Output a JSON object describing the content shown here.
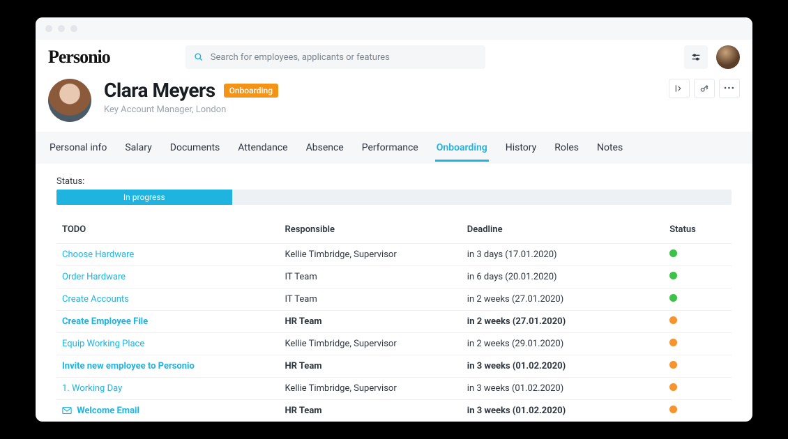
{
  "app": {
    "logo_text": "Personio"
  },
  "search": {
    "placeholder": "Search for employees, applicants or features"
  },
  "profile": {
    "name": "Clara Meyers",
    "badge": "Onboarding",
    "subtitle": "Key Account Manager, London"
  },
  "tabs": [
    {
      "label": "Personal info",
      "active": false
    },
    {
      "label": "Salary",
      "active": false
    },
    {
      "label": "Documents",
      "active": false
    },
    {
      "label": "Attendance",
      "active": false
    },
    {
      "label": "Absence",
      "active": false
    },
    {
      "label": "Performance",
      "active": false
    },
    {
      "label": "Onboarding",
      "active": true
    },
    {
      "label": "History",
      "active": false
    },
    {
      "label": "Roles",
      "active": false
    },
    {
      "label": "Notes",
      "active": false
    }
  ],
  "status": {
    "label": "Status:",
    "progress_text": "In progress",
    "progress_percent": 26
  },
  "table": {
    "headers": {
      "todo": "TODO",
      "responsible": "Responsible",
      "deadline": "Deadline",
      "status": "Status"
    },
    "rows": [
      {
        "todo": "Choose Hardware",
        "responsible": "Kellie Timbridge, Supervisor",
        "deadline": "in 3 days (17.01.2020)",
        "status": "green",
        "bold": false,
        "icon": null
      },
      {
        "todo": "Order Hardware",
        "responsible": "IT Team",
        "deadline": "in 6 days (20.01.2020)",
        "status": "green",
        "bold": false,
        "icon": null
      },
      {
        "todo": "Create Accounts",
        "responsible": "IT Team",
        "deadline": "in 2 weeks (27.01.2020)",
        "status": "green",
        "bold": false,
        "icon": null
      },
      {
        "todo": "Create Employee File",
        "responsible": "HR Team",
        "deadline": "in 2 weeks (27.01.2020)",
        "status": "orange",
        "bold": true,
        "icon": null
      },
      {
        "todo": "Equip Working Place",
        "responsible": "Kellie Timbridge, Supervisor",
        "deadline": "in 2 weeks (29.01.2020)",
        "status": "orange",
        "bold": false,
        "icon": null
      },
      {
        "todo": "Invite new employee to Personio",
        "responsible": "HR Team",
        "deadline": "in 3 weeks (01.02.2020)",
        "status": "orange",
        "bold": true,
        "icon": null
      },
      {
        "todo": "1. Working Day",
        "responsible": "Kellie Timbridge, Supervisor",
        "deadline": "in 3 weeks (01.02.2020)",
        "status": "orange",
        "bold": false,
        "icon": null
      },
      {
        "todo": "Welcome Email",
        "responsible": "HR Team",
        "deadline": "in 3 weeks (01.02.2020)",
        "status": "orange",
        "bold": true,
        "icon": "mail"
      }
    ]
  }
}
